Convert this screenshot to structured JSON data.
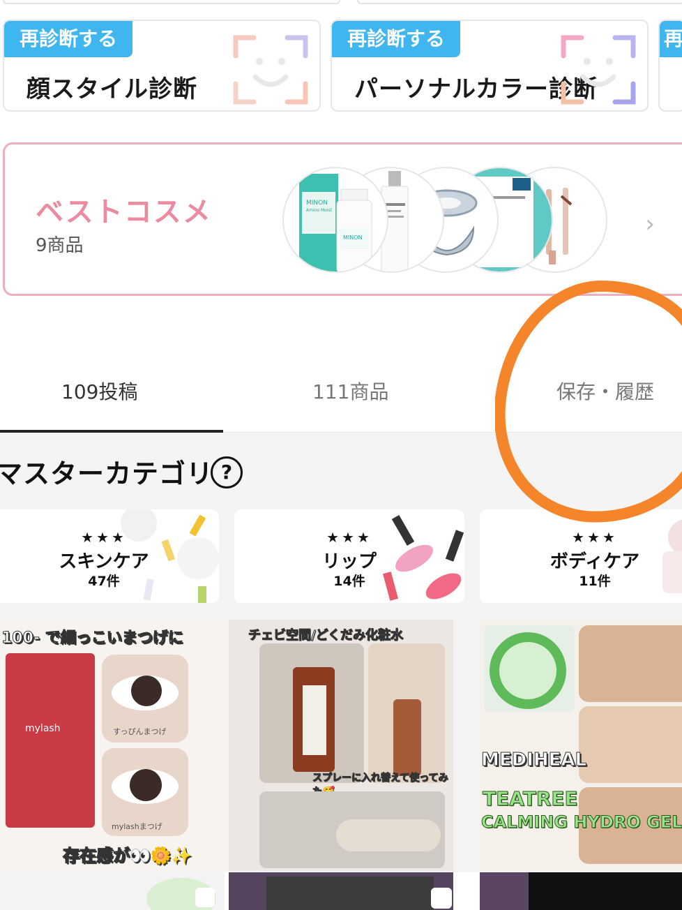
{
  "diagnosis": {
    "badge_label": "再診断する",
    "cards": [
      {
        "title": "顔スタイル診断"
      },
      {
        "title": "パーソナルカラー診断"
      }
    ]
  },
  "best_cosme": {
    "title": "ベストコスメ",
    "count": "9商品",
    "product_labels": [
      "MINON",
      "Amino Moist"
    ]
  },
  "tabs": [
    {
      "label": "109投稿",
      "active": true
    },
    {
      "label": "111商品",
      "active": false
    },
    {
      "label": "保存・履歴",
      "active": false
    }
  ],
  "master_category": {
    "title": "マスターカテゴリ",
    "help_glyph": "?",
    "stars": "★★★",
    "items": [
      {
        "name": "スキンケア",
        "count": "47件"
      },
      {
        "name": "リップ",
        "count": "14件"
      },
      {
        "name": "ボディケア",
        "count": "11件"
      }
    ]
  },
  "posts": [
    {
      "headline": "100- で細っこいまつげに",
      "brand": "mylash",
      "caption": "存在感が👀🌼✨",
      "sub1": "すっぴんまつげ",
      "sub2": "mylashまつげ"
    },
    {
      "headline": "チェビ空間/どくだみ化粧水",
      "caption": "スプレーに入れ替えて使ってみた🥰"
    },
    {
      "brand": "MEDIHEAL",
      "line1": "TEATREE",
      "line2": "CALMING HYDRO GEL"
    }
  ],
  "colors": {
    "accent_blue": "#3fb6ef",
    "pink": "#ec8aa0",
    "annotation_orange": "#f5852a"
  }
}
